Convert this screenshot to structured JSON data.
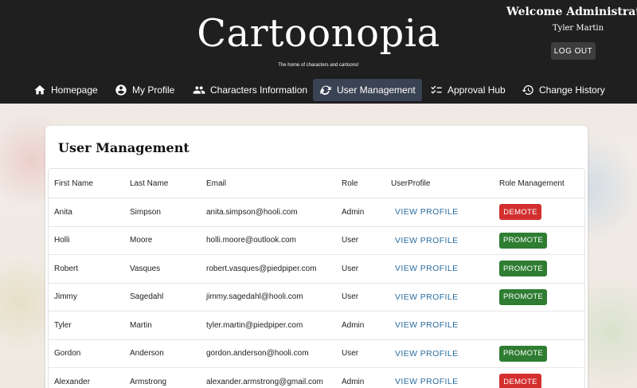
{
  "header": {
    "brand": "Cartoonopia",
    "tagline": "The home of characters and cartoons!",
    "welcome": "Welcome Administrator",
    "user_name": "Tyler Martin",
    "logout_label": "LOG OUT"
  },
  "nav": {
    "items": [
      {
        "label": "Homepage",
        "icon": "home-icon"
      },
      {
        "label": "My Profile",
        "icon": "account-circle-icon"
      },
      {
        "label": "Characters Information",
        "icon": "people-icon"
      },
      {
        "label": "User Management",
        "icon": "manage-accounts-icon",
        "active": true
      },
      {
        "label": "Approval Hub",
        "icon": "checklist-icon"
      },
      {
        "label": "Change History",
        "icon": "history-icon"
      }
    ]
  },
  "main": {
    "title": "User Management",
    "columns": [
      "First Name",
      "Last Name",
      "Email",
      "Role",
      "UserProfile",
      "Role Management"
    ],
    "view_profile_label": "VIEW PROFILE",
    "promote_label": "PROMOTE",
    "demote_label": "DEMOTE",
    "rows": [
      {
        "first": "Anita",
        "last": "Simpson",
        "email": "anita.simpson@hooli.com",
        "role": "Admin",
        "action": "demote"
      },
      {
        "first": "Holli",
        "last": "Moore",
        "email": "holli.moore@outlook.com",
        "role": "User",
        "action": "promote"
      },
      {
        "first": "Robert",
        "last": "Vasques",
        "email": "robert.vasques@piedpiper.com",
        "role": "User",
        "action": "promote"
      },
      {
        "first": "Jimmy",
        "last": "Sagedahl",
        "email": "jimmy.sagedahl@hooli.com",
        "role": "User",
        "action": "promote"
      },
      {
        "first": "Tyler",
        "last": "Martin",
        "email": "tyler.martin@piedpiper.com",
        "role": "Admin",
        "action": "none"
      },
      {
        "first": "Gordon",
        "last": "Anderson",
        "email": "gordon.anderson@hooli.com",
        "role": "User",
        "action": "promote"
      },
      {
        "first": "Alexander",
        "last": "Armstrong",
        "email": "alexander.armstrong@gmail.com",
        "role": "Admin",
        "action": "demote"
      }
    ]
  },
  "colors": {
    "header_bg": "#1f1f1f",
    "active_nav_bg": "#3a4353",
    "promote": "#2e7d32",
    "demote": "#d32f2f",
    "link": "#2a6ea0"
  }
}
